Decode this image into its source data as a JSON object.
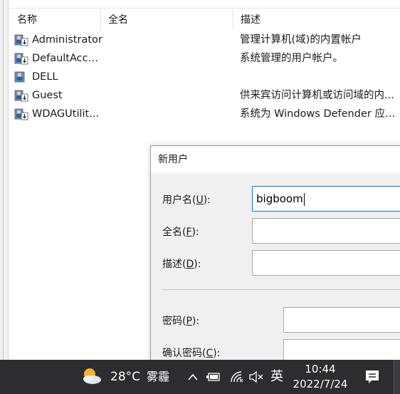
{
  "list": {
    "columns": [
      "名称",
      "全名",
      "描述"
    ],
    "rows": [
      {
        "name": "Administrator",
        "full_name": "",
        "description": "管理计算机(域)的内置帐户"
      },
      {
        "name": "DefaultAcco...",
        "full_name": "",
        "description": "系统管理的用户帐户。"
      },
      {
        "name": "DELL",
        "full_name": "",
        "description": ""
      },
      {
        "name": "Guest",
        "full_name": "",
        "description": "供来宾访问计算机或访问域的内..."
      },
      {
        "name": "WDAGUtilit...",
        "full_name": "",
        "description": "系统为 Windows Defender 应用..."
      }
    ]
  },
  "dialog": {
    "title": "新用户",
    "username": {
      "label": "用户名",
      "hotkey": "U",
      "value": "bigboom"
    },
    "fullname": {
      "label": "全名",
      "hotkey": "F",
      "value": ""
    },
    "description": {
      "label": "描述",
      "hotkey": "D",
      "value": ""
    },
    "password": {
      "label": "密码",
      "hotkey": "P",
      "value": ""
    },
    "confirm_password": {
      "label": "确认密码",
      "hotkey": "C",
      "value": ""
    }
  },
  "taskbar": {
    "weather_temp": "28°C",
    "weather_desc": "雾霾",
    "ime": "英",
    "time": "10:44",
    "date": "2022/7/24",
    "icons": [
      "chevron-up-icon",
      "battery-icon",
      "network-icon",
      "volume-muted-icon",
      "notification-icon"
    ]
  },
  "colors": {
    "taskbar_bg": "#2d2d30",
    "focus_border": "#0078d7",
    "dialog_bg": "#f0f0f0"
  }
}
